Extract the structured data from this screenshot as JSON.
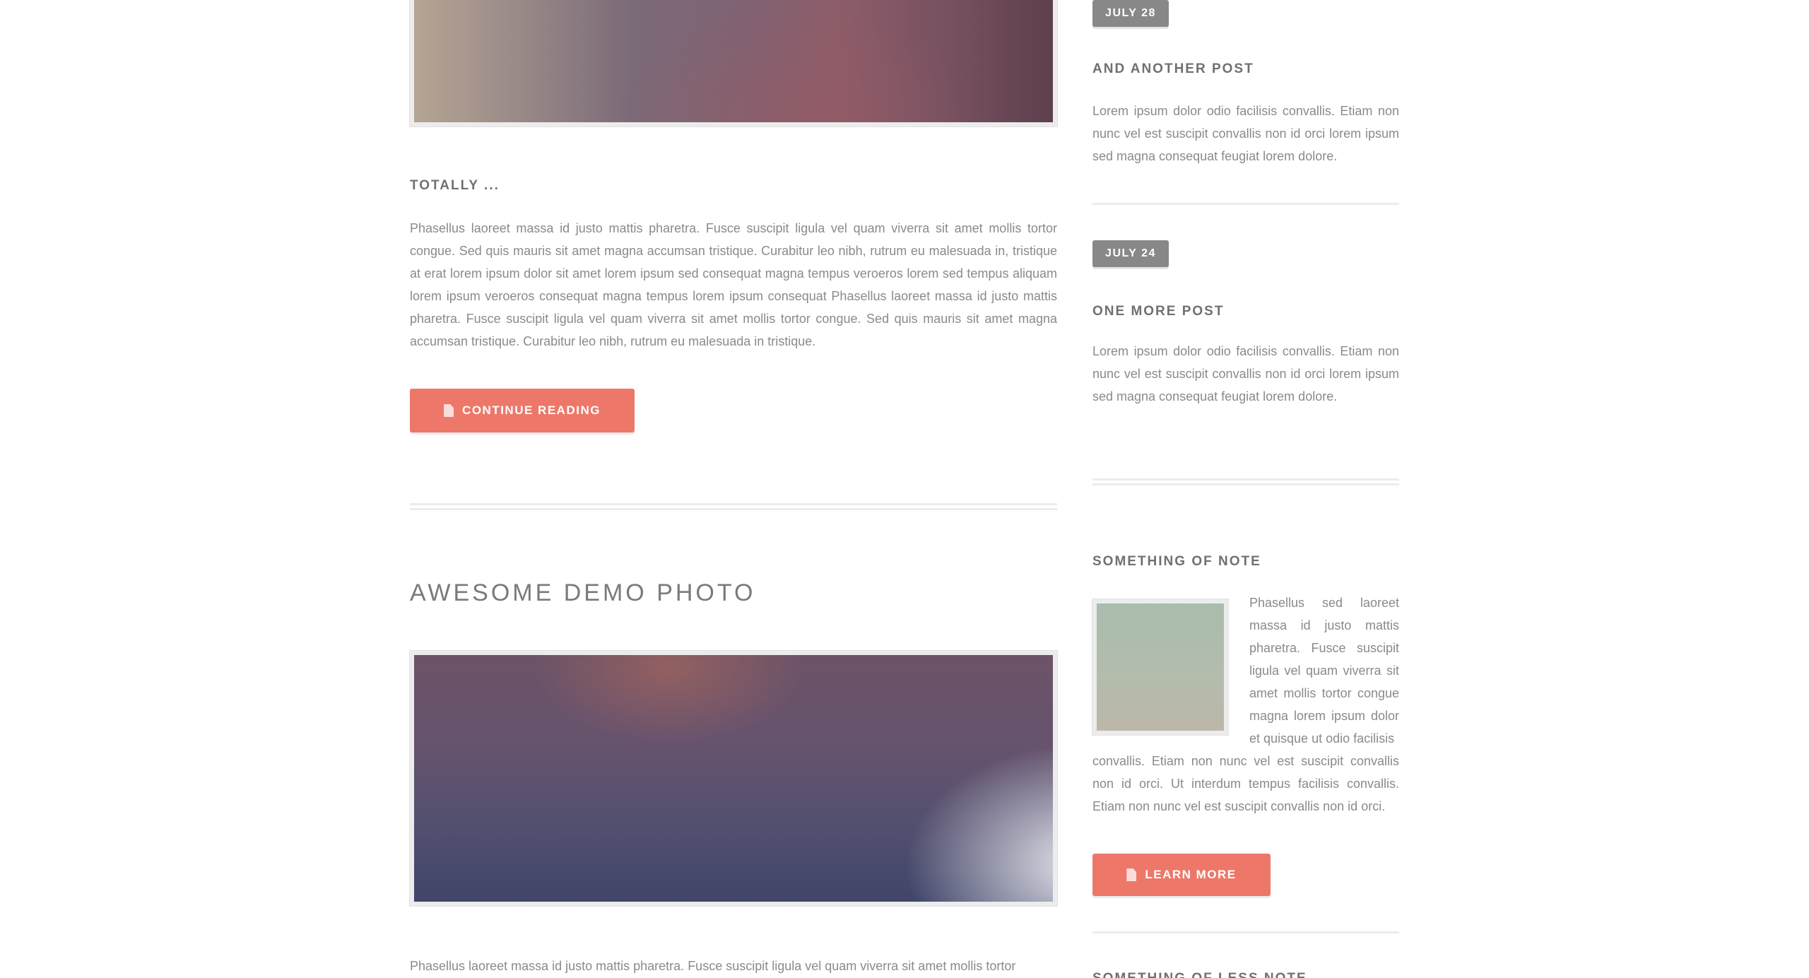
{
  "main": {
    "post1": {
      "heading": "TOTALLY ...",
      "text": "Phasellus laoreet massa id justo mattis pharetra. Fusce suscipit ligula vel quam viverra sit amet mollis tortor congue. Sed quis mauris sit amet magna accumsan tristique. Curabitur leo nibh, rutrum eu malesuada in, tristique at erat lorem ipsum dolor sit amet lorem ipsum sed consequat magna tempus veroeros lorem sed tempus aliquam lorem ipsum veroeros consequat magna tempus lorem ipsum consequat Phasellus laoreet massa id justo mattis pharetra. Fusce suscipit ligula vel quam viverra sit amet mollis tortor congue. Sed quis mauris sit amet magna accumsan tristique. Curabitur leo nibh, rutrum eu malesuada in tristique.",
      "button_label": "CONTINUE READING",
      "button_icon": "document-icon"
    },
    "post2": {
      "title": "AWESOME DEMO PHOTO",
      "text": "Phasellus laoreet massa id justo mattis pharetra. Fusce suscipit ligula vel quam viverra sit amet mollis tortor"
    }
  },
  "sidebar": {
    "entries": [
      {
        "date": "JULY 28",
        "title": "AND ANOTHER POST",
        "text": "Lorem ipsum dolor odio facilisis convallis. Etiam non nunc vel est suscipit convallis non id orci lorem ipsum sed magna consequat feugiat lorem dolore."
      },
      {
        "date": "JULY 24",
        "title": "ONE MORE POST",
        "text": "Lorem ipsum dolor odio facilisis convallis. Etiam non nunc vel est suscipit convallis non id orci lorem ipsum sed magna consequat feugiat lorem dolore."
      }
    ],
    "note": {
      "heading": "SOMETHING OF NOTE",
      "text_top": "Phasellus sed laoreet massa id justo mattis pharetra. Fusce suscipit ligula vel quam viverra sit amet mollis tortor congue magna lorem ipsum dolor et quisque ut odio facilisis",
      "text_bottom": "convallis. Etiam non nunc vel est suscipit convallis non id orci. Ut interdum tempus facilisis convallis. Etiam non nunc vel est suscipit convallis non id orci.",
      "button_label": "LEARN MORE",
      "button_icon": "document-icon"
    },
    "next_heading": "SOMETHING OF LESS NOTE"
  },
  "colors": {
    "accent": "#ed786a",
    "badge": "#888888",
    "rule": "#ececec",
    "text": "#8a8a8a"
  }
}
